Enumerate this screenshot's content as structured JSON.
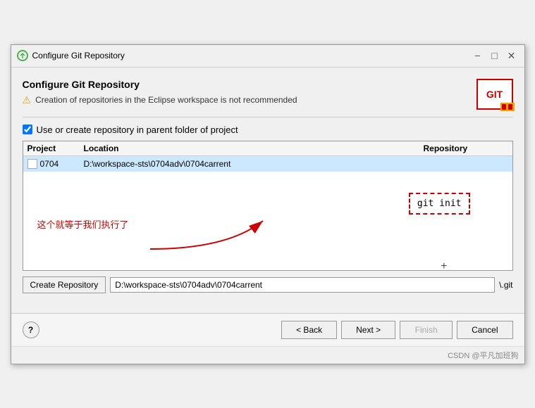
{
  "window": {
    "title": "Configure Git Repository",
    "minimize_label": "−",
    "maximize_label": "□",
    "close_label": "✕"
  },
  "header": {
    "title": "Configure Git Repository",
    "warning": "Creation of repositories in the Eclipse workspace is not recommended",
    "git_logo": "GIT"
  },
  "checkbox": {
    "label": "Use or create repository in parent folder of project",
    "checked": true
  },
  "table": {
    "columns": [
      "Project",
      "Location",
      "Repository"
    ],
    "rows": [
      {
        "project": "0704",
        "location": "D:\\workspace-sts\\0704adv\\0704carrent",
        "repository": ""
      }
    ]
  },
  "annotation": {
    "git_init_text": "git  init",
    "arrow_text": "这个就等于我们执行了"
  },
  "bottom_row": {
    "create_button": "Create Repository",
    "path_value": "D:\\workspace-sts\\0704adv\\0704carrent",
    "suffix": "\\.git"
  },
  "buttons": {
    "help_label": "?",
    "back_label": "< Back",
    "next_label": "Next >",
    "finish_label": "Finish",
    "cancel_label": "Cancel"
  },
  "watermark": "CSDN @平凡加班狗"
}
